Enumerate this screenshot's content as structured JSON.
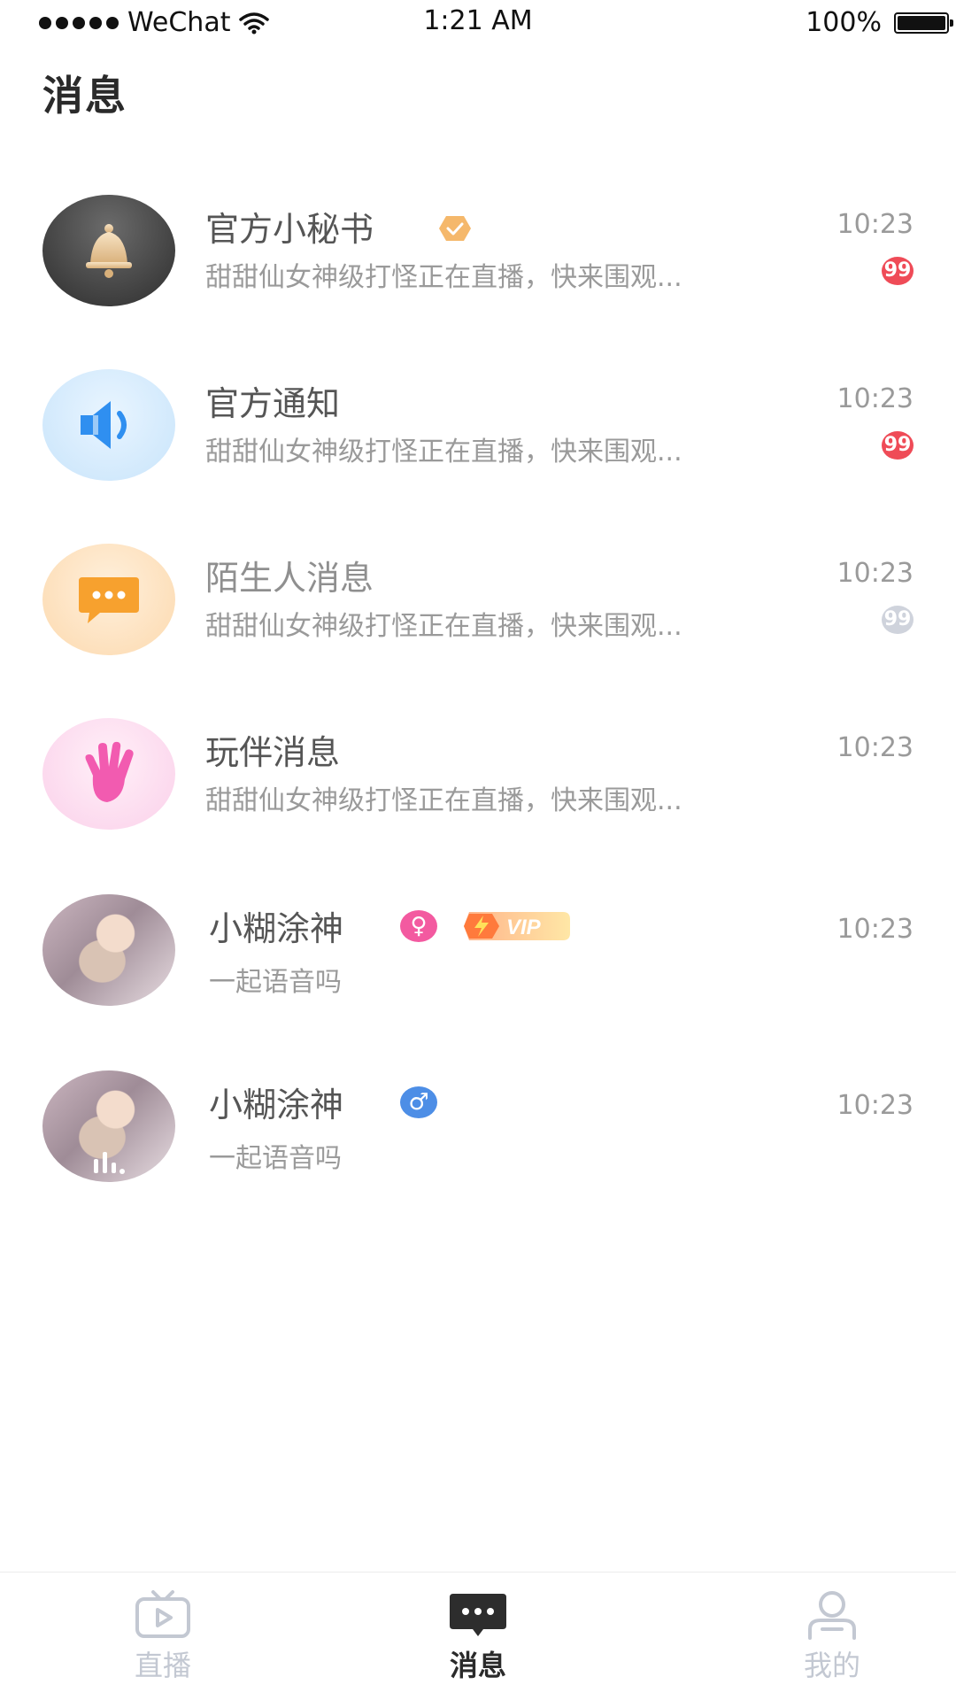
{
  "status_bar": {
    "carrier": "WeChat",
    "time": "1:21 AM",
    "battery": "100%"
  },
  "page": {
    "title": "消息"
  },
  "messages": [
    {
      "name": "官方小秘书",
      "preview": "甜甜仙女神级打怪正在直播，快来围观...",
      "time": "10:23",
      "badge": "99",
      "avatar_icon": "bell-icon",
      "verified": true
    },
    {
      "name": "官方通知",
      "preview": "甜甜仙女神级打怪正在直播，快来围观...",
      "time": "10:23",
      "badge": "99",
      "avatar_icon": "speaker-icon"
    },
    {
      "name": "陌生人消息",
      "preview": "甜甜仙女神级打怪正在直播，快来围观...",
      "time": "10:23",
      "badge": "99",
      "badge_muted": true,
      "avatar_icon": "chat-bubble-icon"
    },
    {
      "name": "玩伴消息",
      "preview": "甜甜仙女神级打怪正在直播，快来围观...",
      "time": "10:23",
      "avatar_icon": "hand-icon"
    },
    {
      "name": "小糊涂神",
      "preview": "一起语音吗",
      "time": "10:23",
      "gender_symbol": "♀",
      "vip_label": "VIP"
    },
    {
      "name": "小糊涂神",
      "preview": "一起语音吗",
      "time": "10:23",
      "gender_symbol": "♂"
    }
  ],
  "tab_bar": {
    "tabs": [
      {
        "label": "直播",
        "icon": "tv-play-icon",
        "active": false
      },
      {
        "label": "消息",
        "icon": "message-bubble-icon",
        "active": true
      },
      {
        "label": "我的",
        "icon": "person-icon",
        "active": false
      }
    ]
  },
  "colors": {
    "badge_red": "#ef4b57",
    "female_pink": "#f35aa0",
    "male_blue": "#4d8ee6",
    "tab_inactive": "#c3c8d2",
    "title_dark": "#2a2a2a"
  }
}
